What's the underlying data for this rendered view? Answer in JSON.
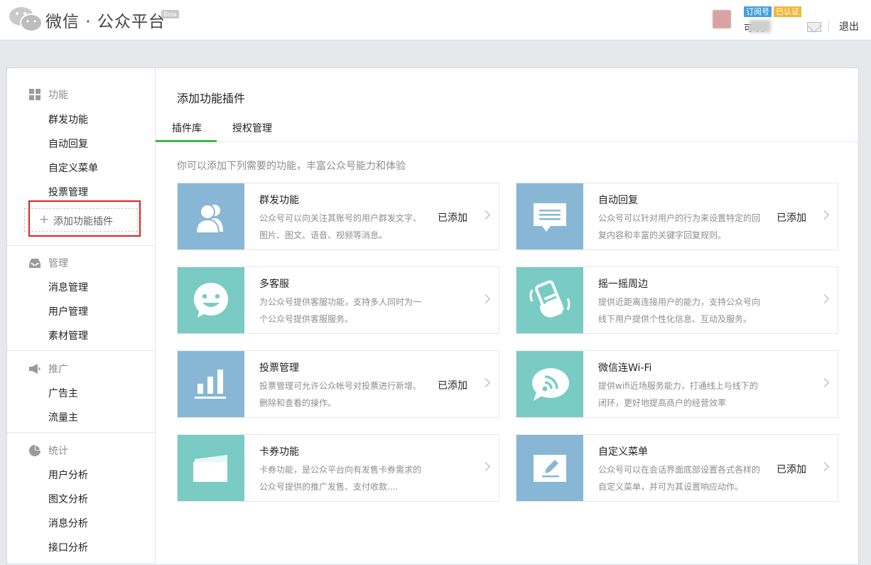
{
  "header": {
    "logo_text": "微信 · 公众平台",
    "beta": "Beta",
    "tag_subscription": "订阅号",
    "tag_verified": "已认证",
    "user_name": "可    力",
    "logout": "退出"
  },
  "sidebar": {
    "groups": [
      {
        "label": "功能",
        "items": [
          "群发功能",
          "自动回复",
          "自定义菜单",
          "投票管理"
        ],
        "add": "添加功能插件"
      },
      {
        "label": "管理",
        "items": [
          "消息管理",
          "用户管理",
          "素材管理"
        ]
      },
      {
        "label": "推广",
        "items": [
          "广告主",
          "流量主"
        ]
      },
      {
        "label": "统计",
        "items": [
          "用户分析",
          "图文分析",
          "消息分析",
          "接口分析"
        ]
      }
    ]
  },
  "main": {
    "title": "添加功能插件",
    "tabs": [
      "插件库",
      "授权管理"
    ],
    "description": "你可以添加下列需要的功能，丰富公众号能力和体验",
    "cards": [
      {
        "title": "群发功能",
        "desc": "公众号可以向关注其账号的用户群发文字、图片、图文、语音、视频等消息。",
        "status": "已添加",
        "icon": "users-icon"
      },
      {
        "title": "自动回复",
        "desc": "公众号可以针对用户的行为来设置特定的回复内容和丰富的关键字回复规则。",
        "status": "已添加",
        "icon": "message-icon"
      },
      {
        "title": "多客服",
        "desc": "为公众号提供客服功能，支持多人同时为一个公众号提供客服服务。",
        "status": "",
        "icon": "smile-icon"
      },
      {
        "title": "摇一摇周边",
        "desc": "提供近距离连接用户的能力，支持公众号向线下用户提供个性化信息、互动及服务。",
        "status": "",
        "icon": "shake-icon"
      },
      {
        "title": "投票管理",
        "desc": "投票管理可允许公众帐号对投票进行新增、删除和查看的操作。",
        "status": "已添加",
        "icon": "bar-chart-icon"
      },
      {
        "title": "微信连Wi-Fi",
        "desc": "提供wifi近场服务能力，打通线上与线下的闭环，更好地提高商户的经营效率",
        "status": "",
        "icon": "wifi-icon"
      },
      {
        "title": "卡券功能",
        "desc": "卡券功能，是公众平台向有发售卡券需求的公众号提供的推广发售、支付收款....",
        "status": "",
        "icon": "card-icon"
      },
      {
        "title": "自定义菜单",
        "desc": "公众号可以在会话界面底部设置各式各样的自定义菜单，并可为其设置响应动作。",
        "status": "已添加",
        "icon": "edit-icon"
      }
    ]
  },
  "colors": {
    "accent_green": "#44b549",
    "icon_blue": "#88b7d5",
    "icon_teal": "#79cbc4"
  }
}
